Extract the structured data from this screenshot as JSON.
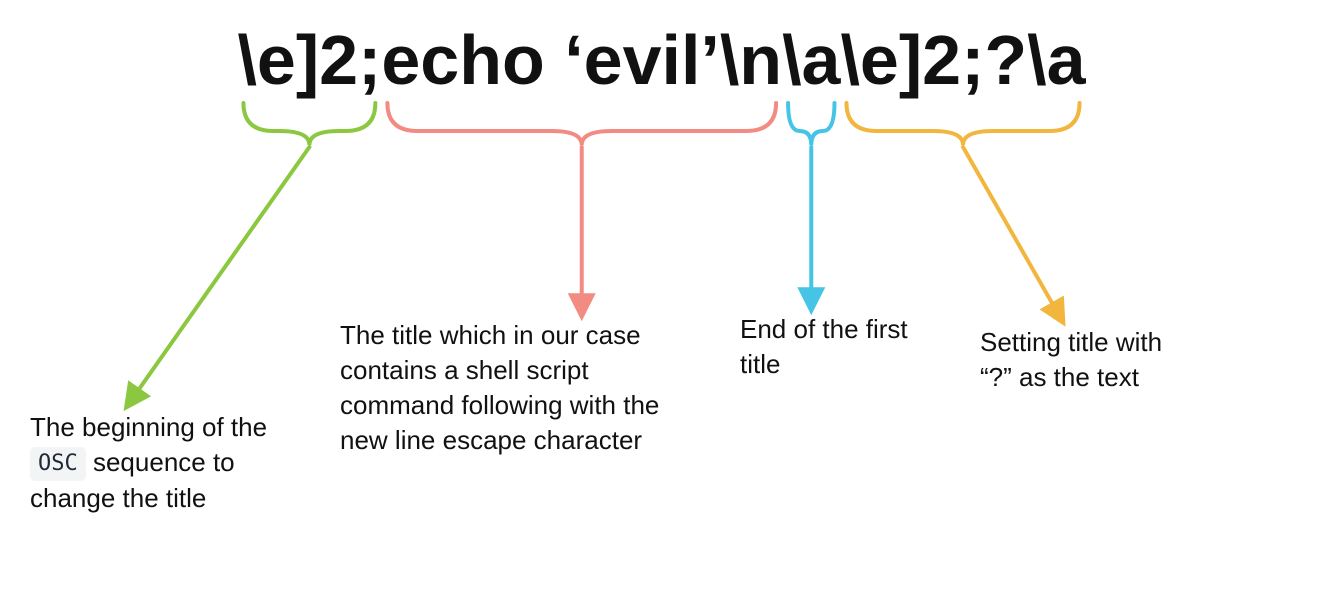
{
  "command": {
    "seg1": "\\e]2;",
    "seg2": "echo ‘evil’\\n",
    "seg3": "\\a",
    "seg4": "\\e]2;?\\a"
  },
  "labels": {
    "l1_part1": "The beginning of the ",
    "l1_chip": "OSC",
    "l1_part2": " sequence to change the title",
    "l2": "The title which in our case contains a shell script command following with the new line escape character",
    "l3": "End of the first title",
    "l4": "Setting title with “?” as the text"
  },
  "colors": {
    "green": "#8cc740",
    "pink": "#f28b82",
    "cyan": "#45c4e6",
    "yellow": "#f2b63e"
  }
}
